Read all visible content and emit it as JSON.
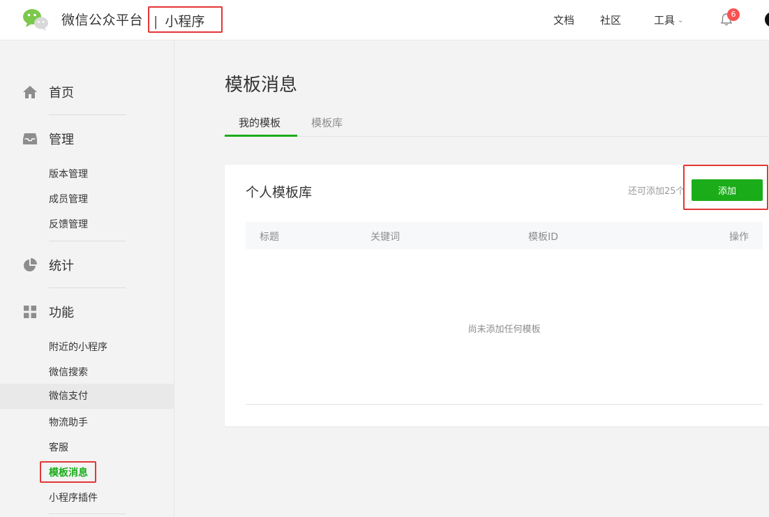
{
  "header": {
    "brand": "微信公众平台",
    "separator": "|",
    "product": "小程序",
    "nav": {
      "docs": "文档",
      "community": "社区",
      "tools": "工具"
    },
    "notification_count": "6",
    "icons": {
      "logo": "wechat-logo",
      "bell": "bell-icon",
      "chevron": "chevron-down-icon"
    }
  },
  "sidebar": {
    "sections": [
      {
        "label": "首页",
        "icon": "home-icon"
      },
      {
        "label": "管理",
        "icon": "inbox-icon",
        "items": [
          "版本管理",
          "成员管理",
          "反馈管理"
        ]
      },
      {
        "label": "统计",
        "icon": "pie-chart-icon"
      },
      {
        "label": "功能",
        "icon": "grid-icon",
        "items": [
          "附近的小程序",
          "微信搜索",
          "微信支付",
          "物流助手",
          "客服",
          "模板消息",
          "小程序插件"
        ]
      }
    ],
    "active_item": "模板消息",
    "hover_item": "微信支付"
  },
  "main": {
    "title": "模板消息",
    "tabs": [
      {
        "label": "我的模板",
        "active": true
      },
      {
        "label": "模板库",
        "active": false
      }
    ],
    "card": {
      "title": "个人模板库",
      "remaining": "还可添加25个",
      "add_label": "添加",
      "columns": [
        "标题",
        "关键词",
        "模板ID",
        "操作"
      ],
      "empty_text": "尚未添加任何模板"
    }
  },
  "colors": {
    "accent": "#1aad19",
    "annotation": "#e53535",
    "badge": "#fa5151"
  }
}
